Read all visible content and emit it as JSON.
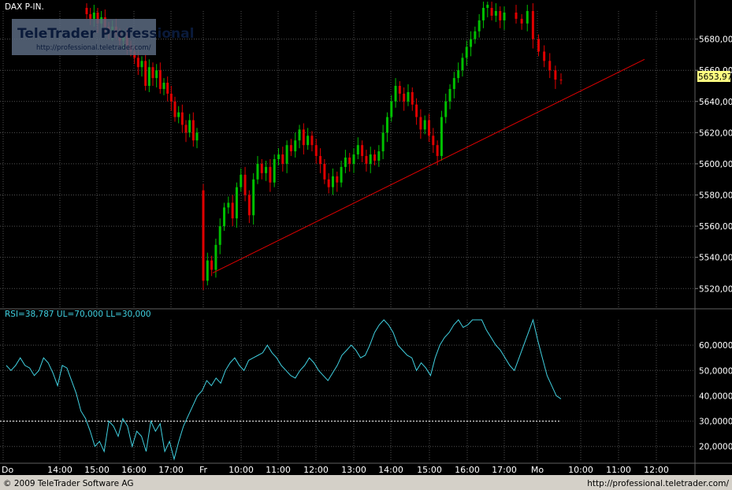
{
  "header": {
    "symbol_label": "DAX P-IN.",
    "rsi_label": "RSI=38,787 UL=70,000 LL=30,000"
  },
  "watermark": {
    "title": "TeleTrader Professional",
    "url": "http://professional.teletrader.com/"
  },
  "footer": {
    "copyright": "© 2009 TeleTrader Software AG",
    "url": "http://professional.teletrader.com/"
  },
  "colors": {
    "background": "#000000",
    "up": "#00c000",
    "down": "#e00000",
    "rsi_line": "#40d0e0",
    "trendline": "#e00000",
    "level_line": "#ffffff",
    "current_price_bg": "#ffff80",
    "axis_text": "#ffffff"
  },
  "chart_data": [
    {
      "type": "candlestick",
      "title": "DAX P-IN.",
      "current_price_label": "5653,97",
      "current_price": 5653.97,
      "ylim": [
        5508,
        5698
      ],
      "y_ticks": [
        5520,
        5540,
        5560,
        5580,
        5600,
        5620,
        5640,
        5660,
        5680
      ],
      "y_tick_labels": [
        "5520,00",
        "5540,00",
        "5560,00",
        "5580,00",
        "5600,00",
        "5620,00",
        "5640,00",
        "5660,00",
        "5680,00"
      ],
      "x_tick_labels": [
        "Do",
        "14:00",
        "15:00",
        "16:00",
        "17:00",
        "Fr",
        "10:00",
        "11:00",
        "12:00",
        "13:00",
        "14:00",
        "15:00",
        "16:00",
        "17:00",
        "Mo",
        "10:00",
        "11:00",
        "12:00"
      ],
      "grid": true,
      "trendline": {
        "start": {
          "x": "Fr 09:15",
          "y": 5530
        },
        "end": {
          "x": "Mo 11:50",
          "y": 5667
        }
      },
      "session_breaks": [
        "Fr",
        "Mo"
      ]
    },
    {
      "type": "line",
      "title": "RSI",
      "value_label": "38,787",
      "upper_limit": 70,
      "lower_limit": 30,
      "ylim": [
        14,
        70
      ],
      "y_ticks": [
        20,
        30,
        40,
        50,
        60
      ],
      "y_tick_labels": [
        "20,0000",
        "30,0000",
        "40,0000",
        "50,0000",
        "60,0000"
      ],
      "grid": true,
      "values": [
        52,
        50,
        52,
        55,
        52,
        51,
        48,
        50,
        55,
        53,
        49,
        44,
        52,
        51,
        46,
        41,
        34,
        31,
        26,
        20,
        22,
        18,
        30,
        28,
        24,
        31,
        28,
        20,
        26,
        24,
        18,
        30,
        26,
        29,
        18,
        22,
        15,
        22,
        28,
        32,
        36,
        40,
        42,
        46,
        44,
        47,
        45,
        50,
        53,
        55,
        52,
        50,
        54,
        55,
        56,
        57,
        60,
        57,
        55,
        52,
        50,
        48,
        47,
        50,
        52,
        55,
        53,
        50,
        48,
        46,
        49,
        52,
        56,
        58,
        60,
        58,
        55,
        56,
        60,
        65,
        68,
        70,
        68,
        65,
        60,
        58,
        56,
        55,
        50,
        53,
        51,
        48,
        55,
        60,
        63,
        65,
        68,
        70,
        67,
        68,
        70,
        72,
        70,
        66,
        63,
        60,
        58,
        55,
        52,
        50,
        55,
        60,
        65,
        70,
        62,
        55,
        48,
        44,
        40,
        38.787
      ]
    }
  ]
}
